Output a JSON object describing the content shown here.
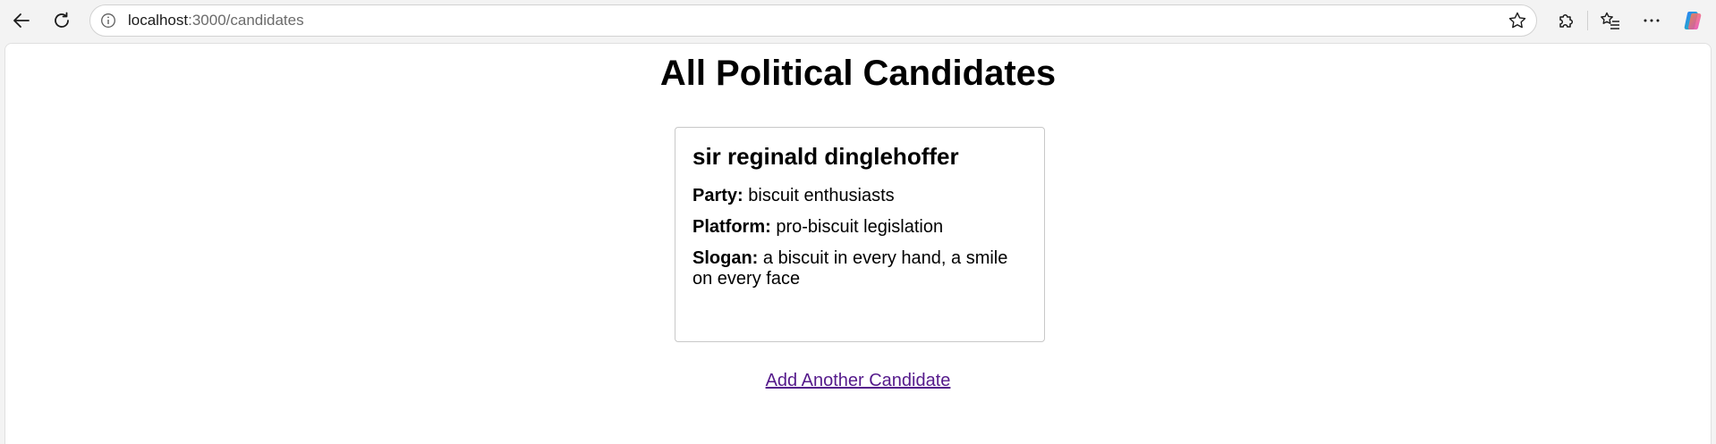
{
  "browser": {
    "url_host": "localhost",
    "url_path": ":3000/candidates"
  },
  "page": {
    "title": "All Political Candidates",
    "add_link": "Add Another Candidate"
  },
  "candidates": [
    {
      "name": "sir reginald dinglehoffer",
      "party_label": "Party:",
      "party": "biscuit enthusiasts",
      "platform_label": "Platform:",
      "platform": "pro-biscuit legislation",
      "slogan_label": "Slogan:",
      "slogan": "a biscuit in every hand, a smile on every face"
    }
  ],
  "colors": {
    "link_visited": "#551a8b",
    "card_border": "#c8c8c8"
  }
}
